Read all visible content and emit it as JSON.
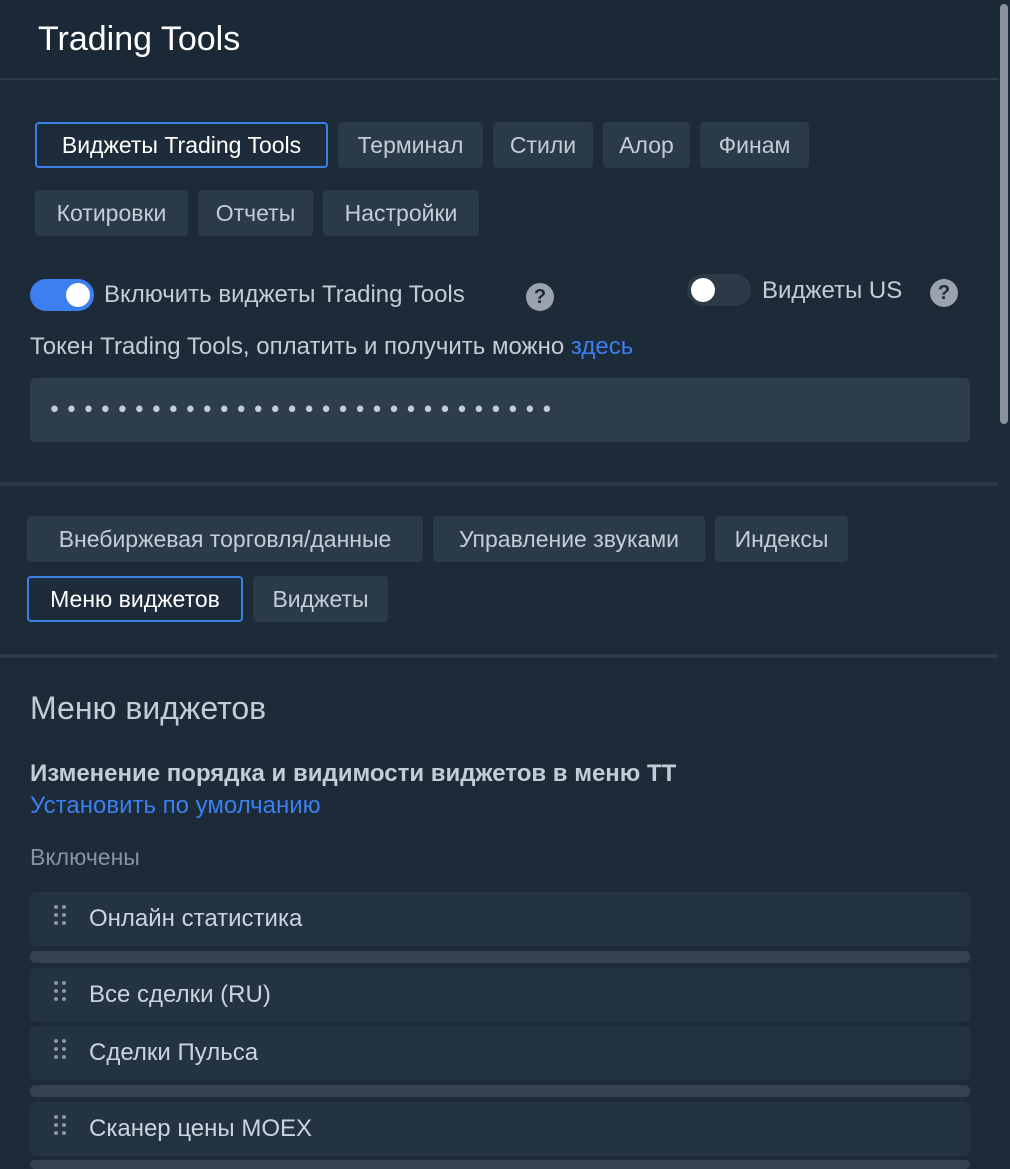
{
  "header": {
    "title": "Trading Tools"
  },
  "tabs_top": [
    {
      "label": "Виджеты Trading Tools",
      "active": true
    },
    {
      "label": "Терминал"
    },
    {
      "label": "Стили"
    },
    {
      "label": "Алор"
    },
    {
      "label": "Финам"
    },
    {
      "label": "Котировки"
    },
    {
      "label": "Отчеты"
    },
    {
      "label": "Настройки"
    }
  ],
  "toggles": {
    "enable_widgets": {
      "label": "Включить виджеты Trading Tools",
      "on": true
    },
    "us_widgets": {
      "label": "Виджеты US",
      "on": false
    }
  },
  "help_icon": "?",
  "token": {
    "label": "Токен Trading Tools, оплатить и получить можно",
    "link_text": "здесь",
    "value": "••••••••••••••••••••••••••••••"
  },
  "tabs_sub": [
    {
      "label": "Внебиржевая торговля/данные"
    },
    {
      "label": "Управление звуками"
    },
    {
      "label": "Индексы"
    },
    {
      "label": "Меню виджетов",
      "active": true
    },
    {
      "label": "Виджеты"
    }
  ],
  "menu_section": {
    "title": "Меню виджетов",
    "subtitle": "Изменение порядка и видимости виджетов в меню ТТ",
    "reset_link": "Установить по умолчанию",
    "enabled_label": "Включены",
    "items": [
      "Онлайн статистика",
      "Все сделки (RU)",
      "Сделки Пульса",
      "Сканер цены MOEX"
    ]
  },
  "colors": {
    "accent": "#3b7ff0",
    "background": "#1d2a38",
    "button": "#2b3a49"
  }
}
